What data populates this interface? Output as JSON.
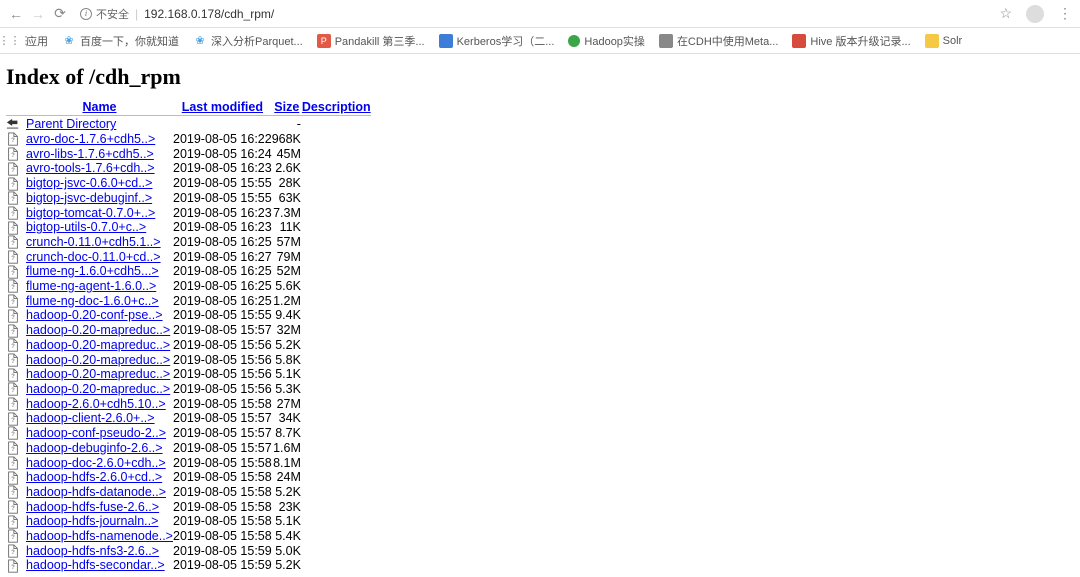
{
  "browser": {
    "security_label": "不安全",
    "url": "192.168.0.178/cdh_rpm/",
    "star": "☆",
    "menu": "⋮"
  },
  "bookmarks": {
    "apps": "应用",
    "items": [
      {
        "icon": "flower",
        "label": "百度一下，你就知道"
      },
      {
        "icon": "flower",
        "label": "深入分析Parquet..."
      },
      {
        "icon": "red",
        "label": "Pandakill 第三季..."
      },
      {
        "icon": "blue",
        "label": "Kerberos学习（二..."
      },
      {
        "icon": "green",
        "label": "Hadoop实操"
      },
      {
        "icon": "gray",
        "label": "在CDH中使用Meta..."
      },
      {
        "icon": "redsq",
        "label": "Hive 版本升级记录..."
      },
      {
        "icon": "yellow",
        "label": "Solr"
      }
    ]
  },
  "page": {
    "title": "Index of /cdh_rpm",
    "columns": {
      "name": "Name",
      "modified": "Last modified",
      "size": "Size",
      "desc": "Description"
    },
    "parent": "Parent Directory",
    "parent_size": "-",
    "files": [
      {
        "n": "avro-doc-1.7.6+cdh5..>",
        "m": "2019-08-05 16:22",
        "s": "968K"
      },
      {
        "n": "avro-libs-1.7.6+cdh5..>",
        "m": "2019-08-05 16:24",
        "s": "45M"
      },
      {
        "n": "avro-tools-1.7.6+cdh..>",
        "m": "2019-08-05 16:23",
        "s": "2.6K"
      },
      {
        "n": "bigtop-jsvc-0.6.0+cd..>",
        "m": "2019-08-05 15:55",
        "s": "28K"
      },
      {
        "n": "bigtop-jsvc-debuginf..>",
        "m": "2019-08-05 15:55",
        "s": "63K"
      },
      {
        "n": "bigtop-tomcat-0.7.0+..>",
        "m": "2019-08-05 16:23",
        "s": "7.3M"
      },
      {
        "n": "bigtop-utils-0.7.0+c..>",
        "m": "2019-08-05 16:23",
        "s": "11K"
      },
      {
        "n": "crunch-0.11.0+cdh5.1..>",
        "m": "2019-08-05 16:25",
        "s": "57M"
      },
      {
        "n": "crunch-doc-0.11.0+cd..>",
        "m": "2019-08-05 16:27",
        "s": "79M"
      },
      {
        "n": "flume-ng-1.6.0+cdh5...>",
        "m": "2019-08-05 16:25",
        "s": "52M"
      },
      {
        "n": "flume-ng-agent-1.6.0..>",
        "m": "2019-08-05 16:25",
        "s": "5.6K"
      },
      {
        "n": "flume-ng-doc-1.6.0+c..>",
        "m": "2019-08-05 16:25",
        "s": "1.2M"
      },
      {
        "n": "hadoop-0.20-conf-pse..>",
        "m": "2019-08-05 15:55",
        "s": "9.4K"
      },
      {
        "n": "hadoop-0.20-mapreduc..>",
        "m": "2019-08-05 15:57",
        "s": "32M"
      },
      {
        "n": "hadoop-0.20-mapreduc..>",
        "m": "2019-08-05 15:56",
        "s": "5.2K"
      },
      {
        "n": "hadoop-0.20-mapreduc..>",
        "m": "2019-08-05 15:56",
        "s": "5.8K"
      },
      {
        "n": "hadoop-0.20-mapreduc..>",
        "m": "2019-08-05 15:56",
        "s": "5.1K"
      },
      {
        "n": "hadoop-0.20-mapreduc..>",
        "m": "2019-08-05 15:56",
        "s": "5.3K"
      },
      {
        "n": "hadoop-2.6.0+cdh5.10..>",
        "m": "2019-08-05 15:58",
        "s": "27M"
      },
      {
        "n": "hadoop-client-2.6.0+..>",
        "m": "2019-08-05 15:57",
        "s": "34K"
      },
      {
        "n": "hadoop-conf-pseudo-2..>",
        "m": "2019-08-05 15:57",
        "s": "8.7K"
      },
      {
        "n": "hadoop-debuginfo-2.6..>",
        "m": "2019-08-05 15:57",
        "s": "1.6M"
      },
      {
        "n": "hadoop-doc-2.6.0+cdh..>",
        "m": "2019-08-05 15:58",
        "s": "8.1M"
      },
      {
        "n": "hadoop-hdfs-2.6.0+cd..>",
        "m": "2019-08-05 15:58",
        "s": "24M"
      },
      {
        "n": "hadoop-hdfs-datanode..>",
        "m": "2019-08-05 15:58",
        "s": "5.2K"
      },
      {
        "n": "hadoop-hdfs-fuse-2.6..>",
        "m": "2019-08-05 15:58",
        "s": "23K"
      },
      {
        "n": "hadoop-hdfs-journaln..>",
        "m": "2019-08-05 15:58",
        "s": "5.1K"
      },
      {
        "n": "hadoop-hdfs-namenode..>",
        "m": "2019-08-05 15:58",
        "s": "5.4K"
      },
      {
        "n": "hadoop-hdfs-nfs3-2.6..>",
        "m": "2019-08-05 15:59",
        "s": "5.0K"
      },
      {
        "n": "hadoop-hdfs-secondar..>",
        "m": "2019-08-05 15:59",
        "s": "5.2K"
      }
    ]
  }
}
